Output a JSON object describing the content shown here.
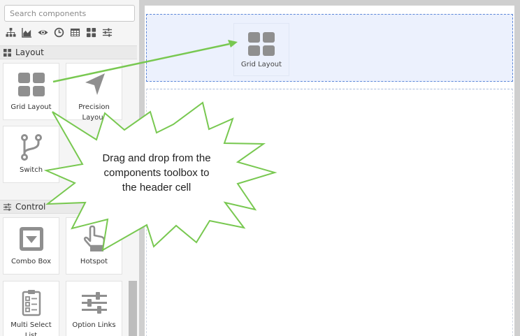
{
  "search": {
    "placeholder": "Search components",
    "value": ""
  },
  "filters": [
    {
      "name": "hierarchy-icon"
    },
    {
      "name": "area-chart-icon"
    },
    {
      "name": "eye-icon"
    },
    {
      "name": "clock-icon"
    },
    {
      "name": "table-icon"
    },
    {
      "name": "grid-icon"
    },
    {
      "name": "sliders-icon"
    }
  ],
  "sections": {
    "layout": {
      "label": "Layout",
      "icon": "grid-icon"
    },
    "control": {
      "label": "Control",
      "icon": "sliders-icon"
    }
  },
  "components": {
    "grid_layout": {
      "label": "Grid Layout",
      "icon": "grid-layout-icon"
    },
    "precision_layout": {
      "label": "Precision Layout",
      "icon": "arrow-pointer-icon"
    },
    "switch": {
      "label": "Switch",
      "icon": "branch-icon"
    },
    "combo_box": {
      "label": "Combo Box",
      "icon": "dropdown-icon"
    },
    "hotspot": {
      "label": "Hotspot",
      "icon": "hand-pointer-icon"
    },
    "multi_select_list": {
      "label": "Multi Select List",
      "icon": "checklist-icon"
    },
    "option_links": {
      "label": "Option Links",
      "icon": "sliders-icon"
    }
  },
  "canvas": {
    "drop_ghost_label": "Grid Layout"
  },
  "callout": {
    "line1": "Drag and drop from the",
    "line2": "components toolbox to",
    "line3": "the header cell"
  },
  "colors": {
    "arrow": "#78c850",
    "callout_border": "#78c850",
    "header_cell_border": "#5b86d8",
    "header_cell_fill": "#ecf1fd",
    "icon_gray": "#8f8f8f"
  }
}
